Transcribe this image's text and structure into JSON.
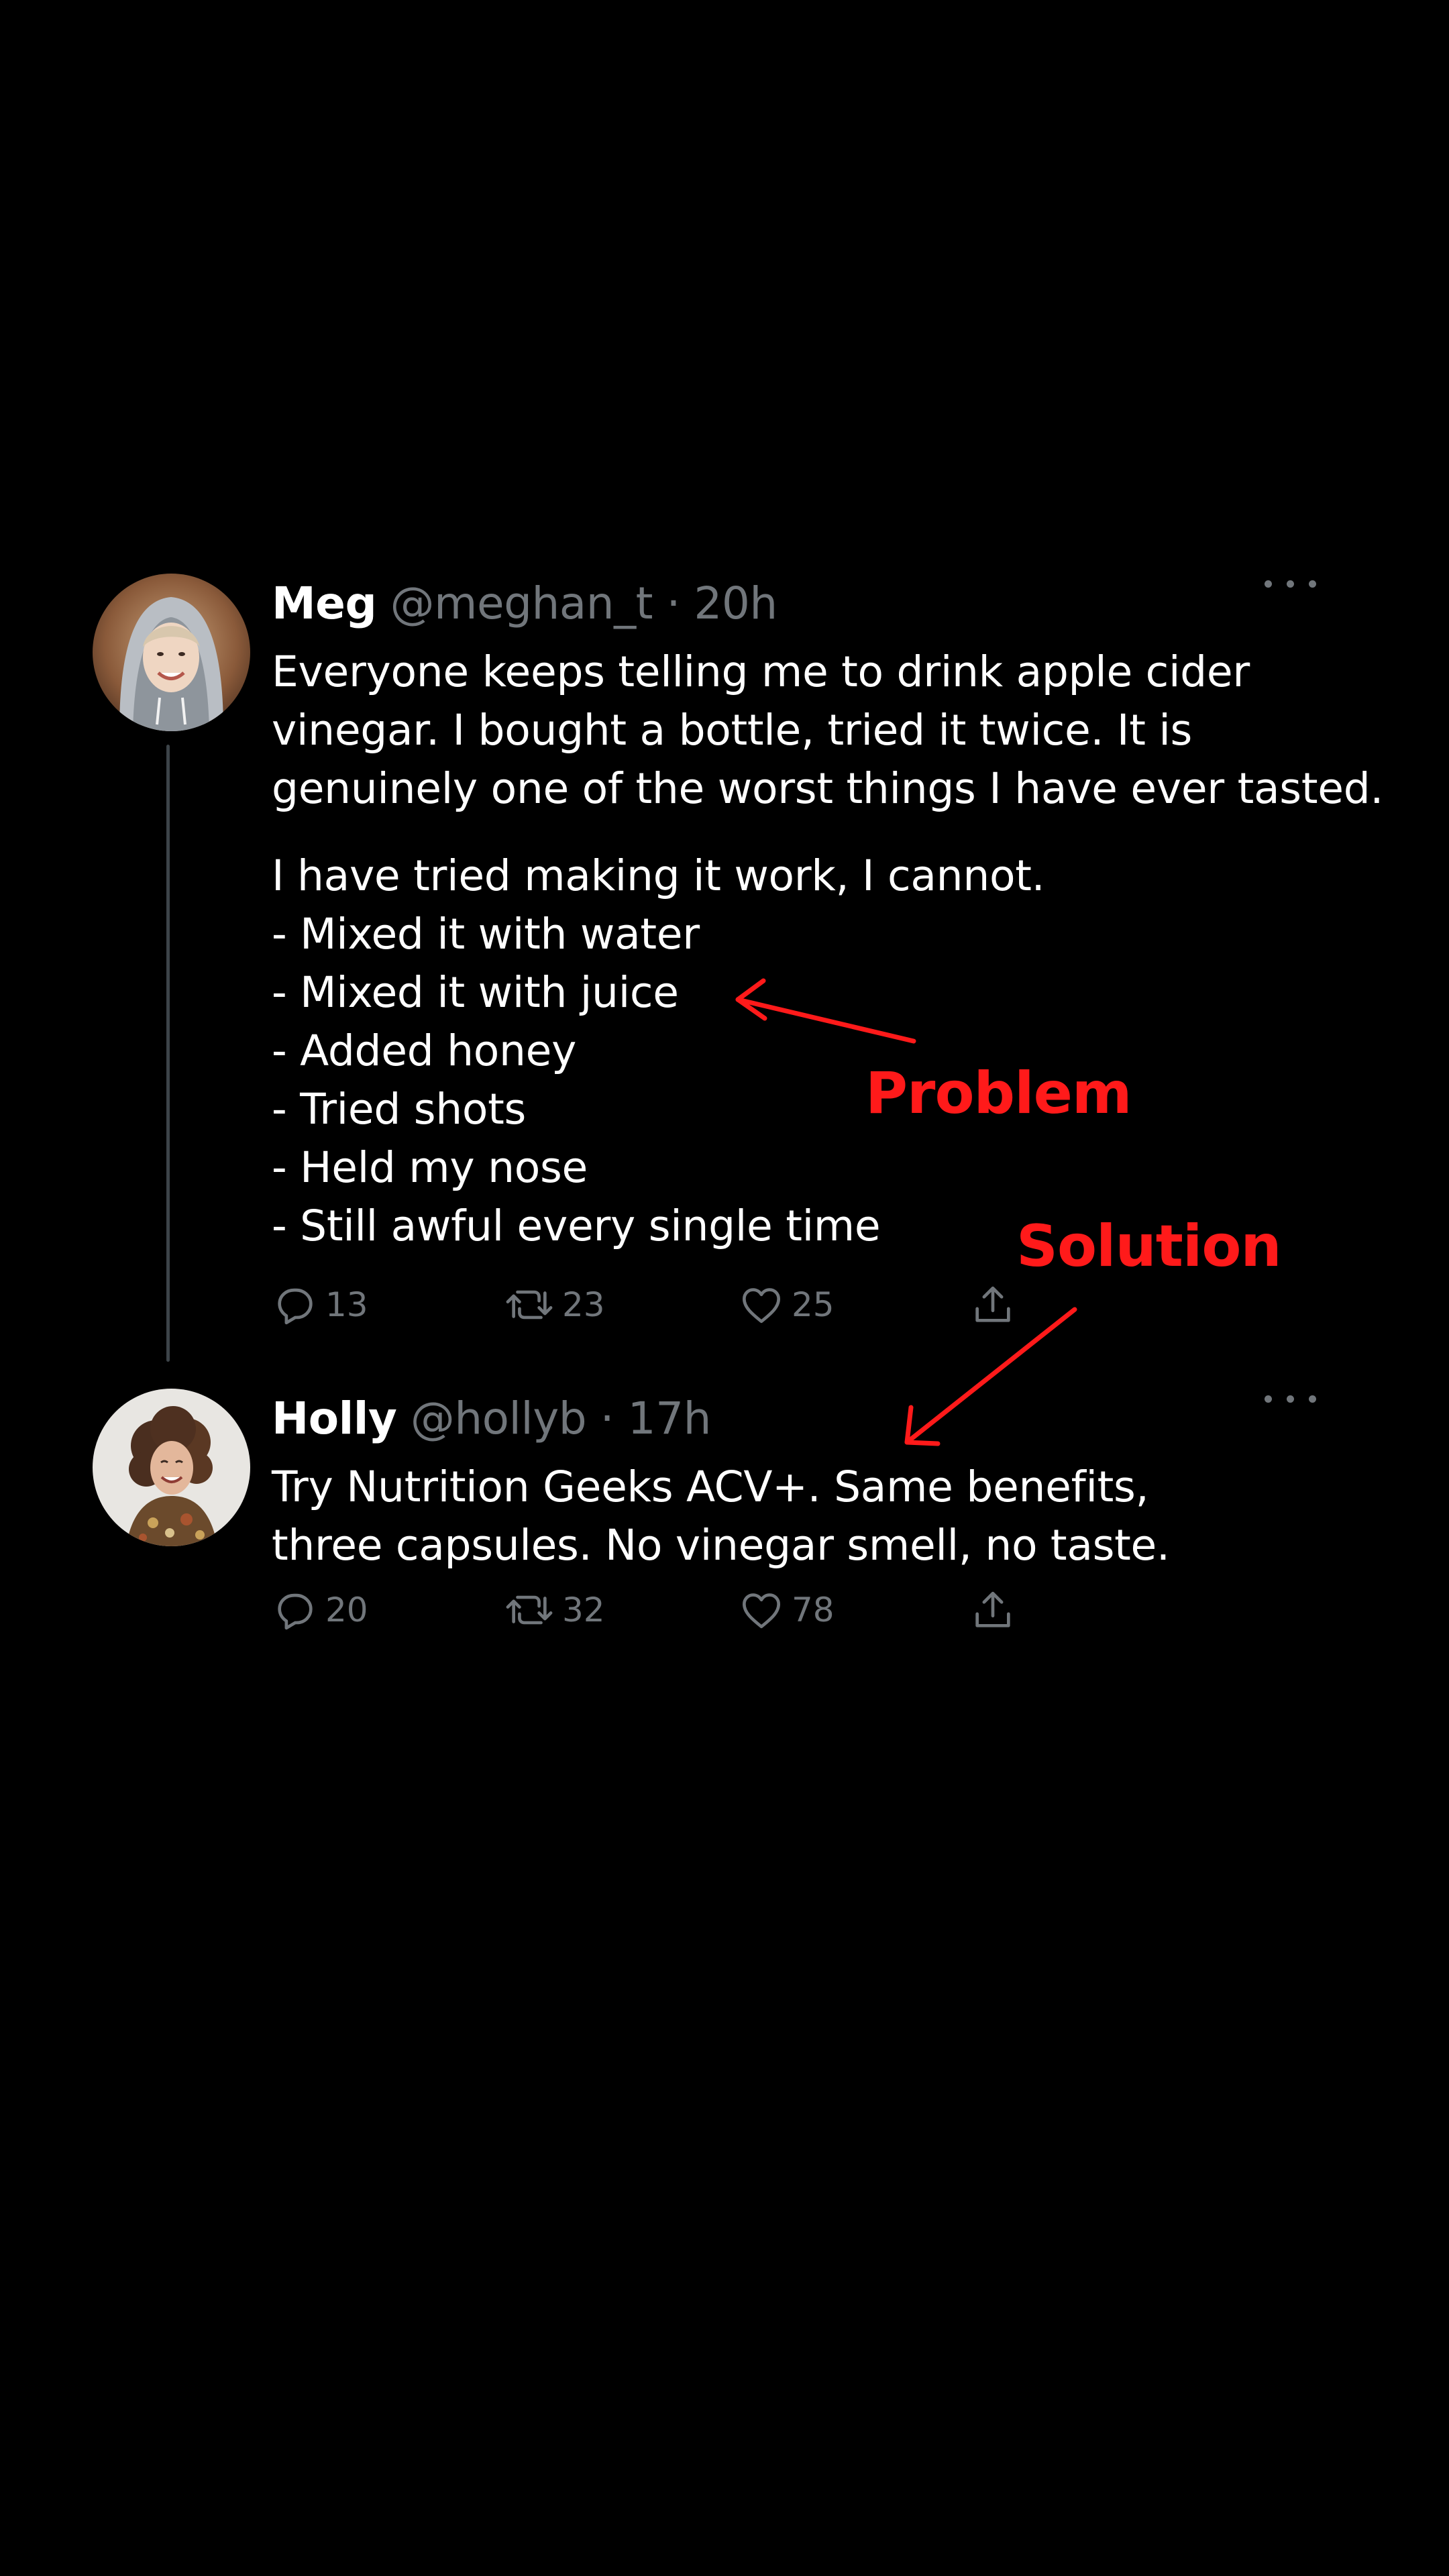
{
  "tweets": [
    {
      "name": "Meg",
      "handle": "@meghan_t",
      "separator": "·",
      "time": "20h",
      "paragraphs": [
        [
          "Everyone keeps telling me to drink apple cider",
          "vinegar. I bought a bottle, tried it twice. It is",
          "genuinely one of the worst things I have ever tasted."
        ],
        [
          "I have tried making it work, I cannot.",
          "- Mixed it with water",
          "- Mixed it with juice",
          "- Added honey",
          "- Tried shots",
          "- Held my nose",
          "- Still awful every single time"
        ]
      ],
      "counts": {
        "replies": "13",
        "retweets": "23",
        "likes": "25"
      },
      "icons": {
        "more": "more-icon",
        "reply": "reply-icon",
        "retweet": "retweet-icon",
        "like": "heart-icon",
        "share": "share-icon"
      }
    },
    {
      "name": "Holly",
      "handle": "@hollyb",
      "separator": "·",
      "time": "17h",
      "paragraphs": [
        [
          "Try Nutrition Geeks ACV+. Same benefits,",
          "three capsules. No vinegar smell, no taste."
        ]
      ],
      "counts": {
        "replies": "20",
        "retweets": "32",
        "likes": "78"
      },
      "icons": {
        "more": "more-icon",
        "reply": "reply-icon",
        "retweet": "retweet-icon",
        "like": "heart-icon",
        "share": "share-icon"
      }
    }
  ],
  "annotations": {
    "problem": "Problem",
    "solution": "Solution",
    "color": "#ff1a1a"
  },
  "colors": {
    "background": "#000000",
    "text": "#ffffff",
    "muted": "#71767b",
    "thread_line": "#3d4449"
  }
}
